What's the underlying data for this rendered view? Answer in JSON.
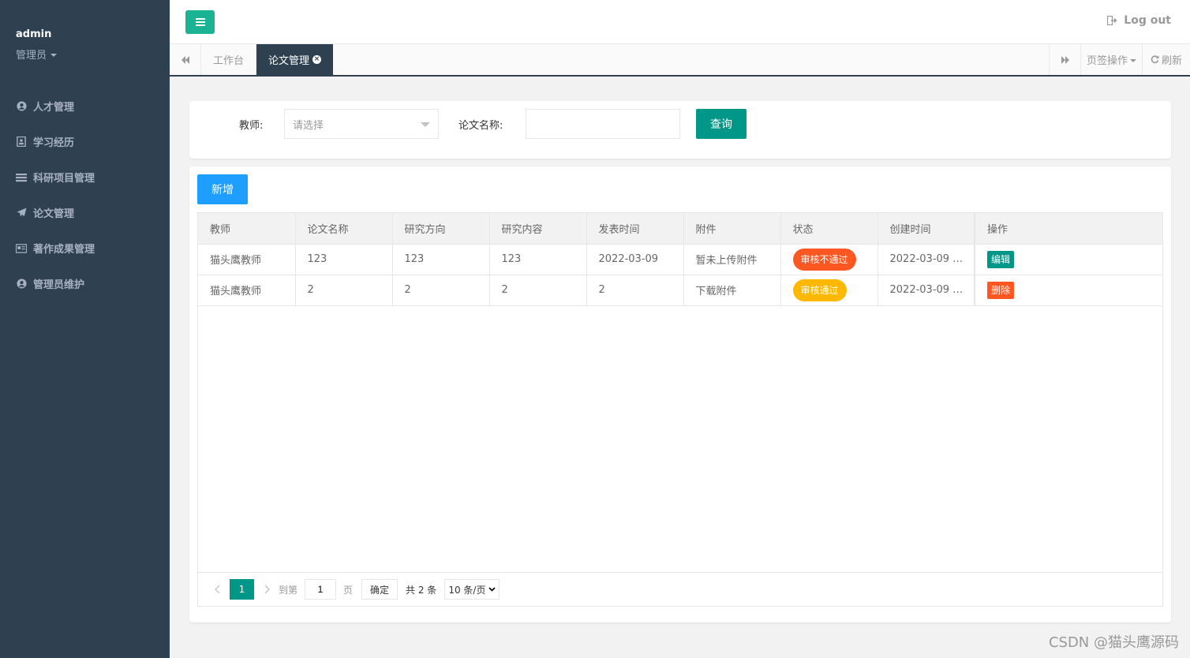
{
  "sidebar": {
    "user_name": "admin",
    "user_role": "管理员",
    "items": [
      {
        "label": "人才管理",
        "icon": "user-circle-icon"
      },
      {
        "label": "学习经历",
        "icon": "id-card-icon"
      },
      {
        "label": "科研项目管理",
        "icon": "list-icon"
      },
      {
        "label": "论文管理",
        "icon": "paper-plane-icon"
      },
      {
        "label": "著作成果管理",
        "icon": "book-card-icon"
      },
      {
        "label": "管理员维护",
        "icon": "user-circle-icon"
      }
    ]
  },
  "header": {
    "logout_label": "Log out"
  },
  "tabs": {
    "home_label": "工作台",
    "active_label": "论文管理",
    "ops_label": "页签操作",
    "refresh_label": "刷新"
  },
  "search": {
    "teacher_label": "教师:",
    "teacher_placeholder": "请选择",
    "paper_label": "论文名称:",
    "paper_value": "",
    "query_label": "查询"
  },
  "table": {
    "add_label": "新增",
    "columns": [
      "教师",
      "论文名称",
      "研究方向",
      "研究内容",
      "发表时间",
      "附件",
      "状态",
      "创建时间",
      "操作"
    ],
    "rows": [
      {
        "teacher": "猫头鹰教师",
        "title": "123",
        "direction": "123",
        "content": "123",
        "published": "2022-03-09",
        "attachment": "暂未上传附件",
        "status": "审核不通过",
        "created": "2022-03-09 …",
        "action": "编辑"
      },
      {
        "teacher": "猫头鹰教师",
        "title": "2",
        "direction": "2",
        "content": "2",
        "published": "2",
        "attachment": "下载附件",
        "status": "审核通过",
        "created": "2022-03-09 …",
        "action": "删除"
      }
    ]
  },
  "pager": {
    "current_page": "1",
    "goto_label": "到第",
    "goto_value": "1",
    "page_unit": "页",
    "confirm_label": "确定",
    "total_label": "共 2 条",
    "page_size": "10 条/页"
  },
  "watermark": "CSDN @猫头鹰源码",
  "colors": {
    "sidebar_bg": "#2f4050",
    "accent_green": "#1ab394",
    "primary_teal": "#009688",
    "add_blue": "#1e9fff",
    "danger_orange": "#ff5722",
    "warn_yellow": "#ffb800"
  }
}
